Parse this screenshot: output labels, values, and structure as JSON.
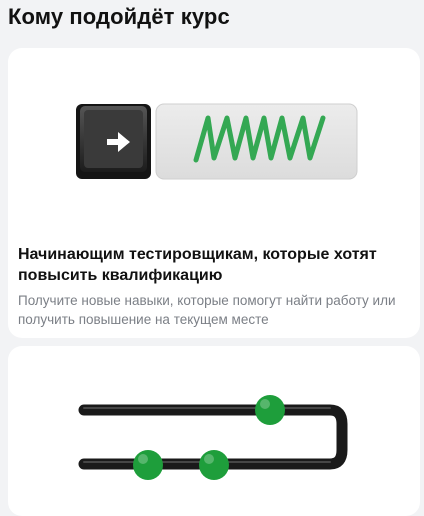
{
  "section": {
    "title": "Кому подойдёт курс"
  },
  "cards": [
    {
      "title": "Начинающим тестировщикам, которые хотят повысить квалификацию",
      "description": "Получите новые навыки, которые помогут найти работу или получить повышение на текущем месте",
      "illustration": "play-key-and-zigzag-screen"
    },
    {
      "illustration": "abacus-beads-rail"
    }
  ],
  "colors": {
    "accent_green": "#34a853",
    "bead_green": "#1e9e3b",
    "key_dark": "#2d2d2d",
    "screen_gray": "#e4e4e4"
  }
}
